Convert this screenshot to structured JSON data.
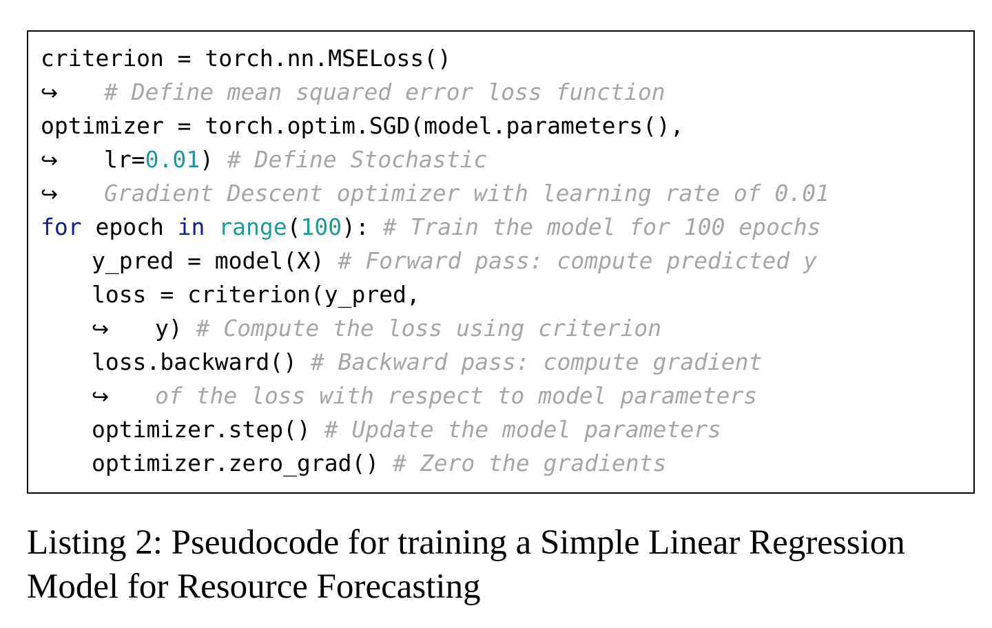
{
  "listing": {
    "l1": {
      "code": "criterion = torch.nn.MSELoss()"
    },
    "l2": {
      "arrow": "↪",
      "comment": "# Define mean squared error loss function"
    },
    "l3": {
      "code": "optimizer = torch.optim.SGD(model.parameters(),"
    },
    "l4": {
      "arrow": "↪",
      "code_a": "lr=",
      "num": "0.01",
      "code_b": ") ",
      "comment": "# Define Stochastic"
    },
    "l5": {
      "arrow": "↪",
      "comment": "Gradient Descent optimizer with learning rate of 0.01"
    },
    "l6": {
      "kw_for": "for",
      "code_a": " epoch ",
      "kw_in": "in",
      "space": " ",
      "builtin": "range",
      "paren": "(",
      "num": "100",
      "code_b": "): ",
      "comment": "# Train the model for 100 epochs"
    },
    "l7": {
      "code": "y_pred = model(X) ",
      "comment": "# Forward pass: compute predicted y"
    },
    "l8": {
      "code": "loss = criterion(y_pred,"
    },
    "l9": {
      "arrow": "↪",
      "code": "y) ",
      "comment": "# Compute the loss using criterion"
    },
    "l10": {
      "code": "loss.backward() ",
      "comment": "# Backward pass: compute gradient"
    },
    "l11": {
      "arrow": "↪",
      "comment": "of the loss with respect to model parameters"
    },
    "l12": {
      "code": "optimizer.step() ",
      "comment": "# Update the model parameters"
    },
    "l13": {
      "code": "optimizer.zero_grad() ",
      "comment": "# Zero the gradients"
    }
  },
  "caption": {
    "text": "Listing 2: Pseudocode for training a Simple Linear Regression Model for Resource Forecasting"
  },
  "colors": {
    "comment": "#a6a6a6",
    "keyword": "#0a1d9c",
    "number": "#1a9a9a",
    "builtin": "#1a9a9a"
  }
}
